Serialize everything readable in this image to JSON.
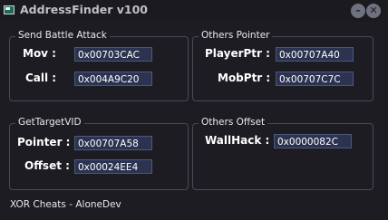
{
  "window": {
    "title": "AddressFinder v100",
    "minimize_symbol": "–",
    "close_symbol": "✕"
  },
  "groups": {
    "send_battle_attack": {
      "title": "Send Battle Attack",
      "rows": [
        {
          "label": "Mov :",
          "value": "0x00703CAC"
        },
        {
          "label": "Call :",
          "value": "0x004A9C20"
        }
      ]
    },
    "others_pointer": {
      "title": "Others Pointer",
      "rows": [
        {
          "label": "PlayerPtr :",
          "value": "0x00707A40"
        },
        {
          "label": "MobPtr :",
          "value": "0x00707C7C"
        }
      ]
    },
    "get_target_vid": {
      "title": "GetTargetVID",
      "rows": [
        {
          "label": "Pointer :",
          "value": "0x00707A58"
        },
        {
          "label": "Offset :",
          "value": "0x00024EE4"
        }
      ]
    },
    "others_offset": {
      "title": "Others Offset",
      "rows": [
        {
          "label": "WallHack :",
          "value": "0x0000082C"
        }
      ]
    }
  },
  "footer": {
    "status": "XOR Cheats - AloneDev"
  },
  "colors": {
    "background": "#1c1c22",
    "field_background": "#2b3350",
    "field_border": "#4d5878",
    "group_border": "#4a4a55"
  }
}
